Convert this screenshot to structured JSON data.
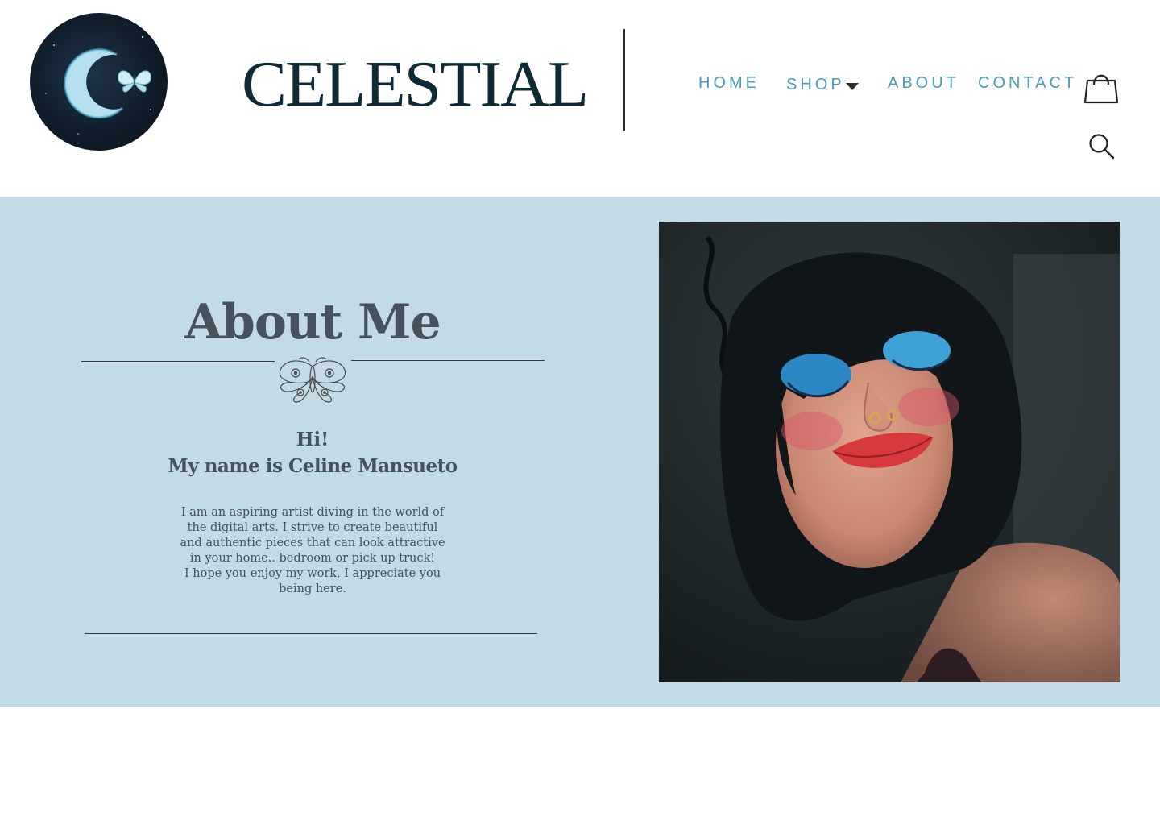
{
  "header": {
    "brand": "CELESTIAL",
    "nav": {
      "home": "HOME",
      "shop": "SHOP",
      "about": "ABOUT",
      "contact": "CONTACT"
    },
    "icons": [
      "shopping-bag-icon",
      "search-icon",
      "chevron-down-icon"
    ]
  },
  "about": {
    "title": "About Me",
    "greeting": "Hi!",
    "name_line": "My name is Celine Mansueto",
    "bio_lines": [
      "I am an aspiring artist diving in the world of",
      "the digital arts. I strive to create beautiful",
      "and authentic pieces that can look attractive",
      "in your home.. bedroom or pick up truck!",
      "I hope you enjoy my work, I appreciate you",
      "being here."
    ]
  },
  "colors": {
    "nav_accent": "#4a9cbc",
    "band_background": "#c3dbe6",
    "heading_text": "#46525d",
    "brand_text": "#0e2a35"
  }
}
